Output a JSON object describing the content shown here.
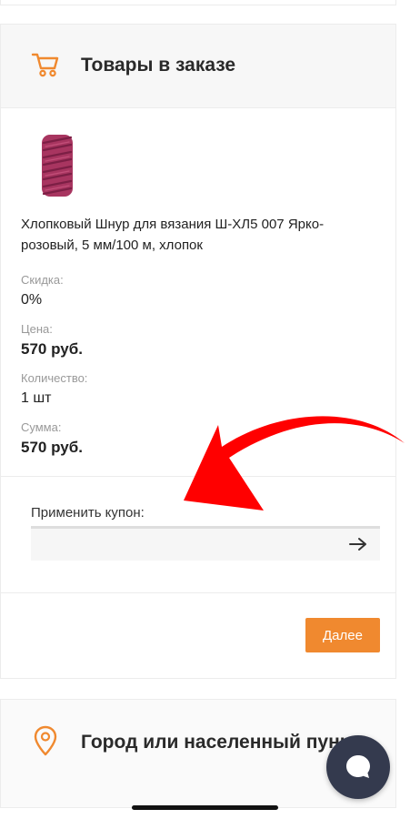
{
  "order": {
    "title": "Товары в заказе",
    "product": {
      "name": "Хлопковый Шнур для вязания Ш-ХЛ5 007 Ярко-розовый, 5 мм/100 м, хлопок",
      "discount_label": "Скидка:",
      "discount_value": "0%",
      "price_label": "Цена:",
      "price_value": "570 руб.",
      "quantity_label": "Количество:",
      "quantity_value": "1 шт",
      "total_label": "Сумма:",
      "total_value": "570 руб."
    },
    "coupon": {
      "label": "Применить купон:",
      "value": "",
      "placeholder": ""
    },
    "next_label": "Далее"
  },
  "city": {
    "title": "Город или населенный пункт"
  },
  "colors": {
    "accent": "#f0892f",
    "annotation_arrow": "#ff0000",
    "chat_button": "#343a4e"
  },
  "icons": {
    "cart": "cart-icon",
    "location": "location-pin-icon",
    "submit": "arrow-right-icon",
    "chat": "chat-bubble-icon"
  }
}
